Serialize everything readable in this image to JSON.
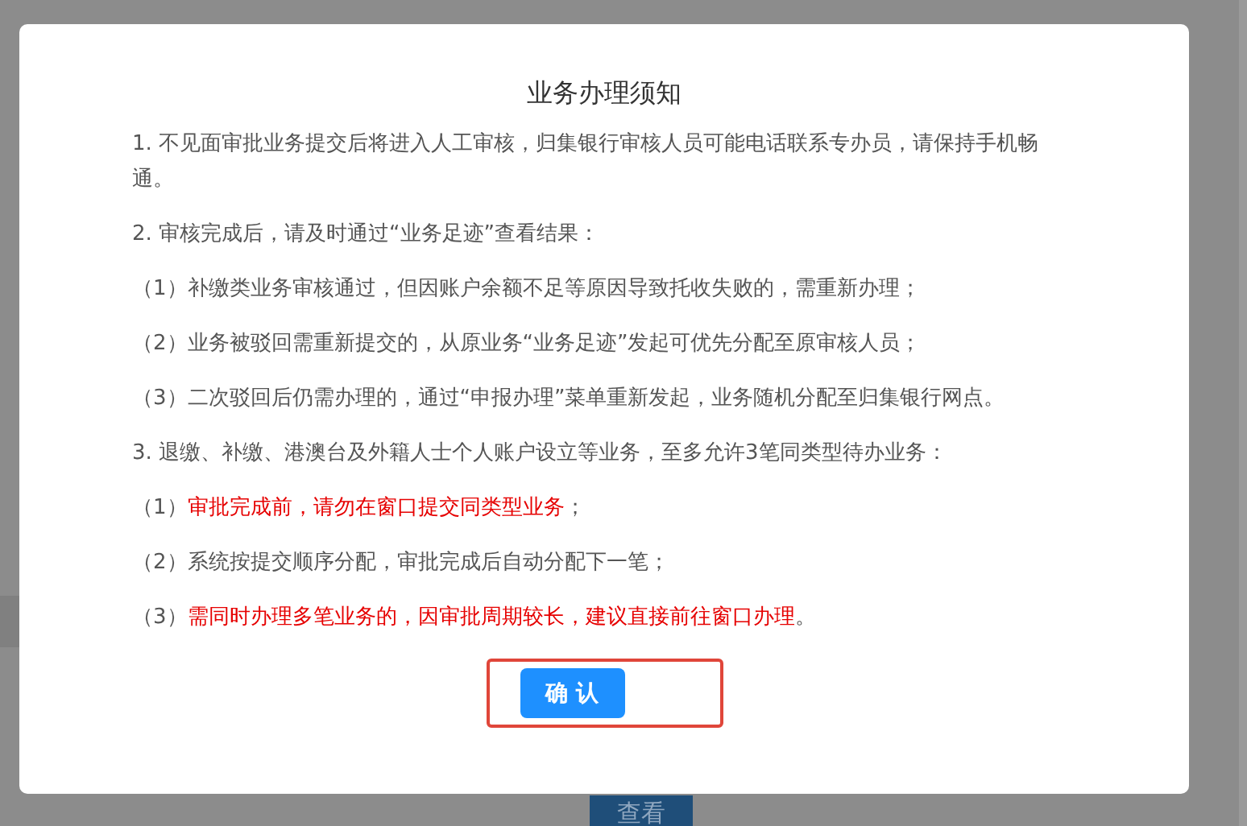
{
  "background": {
    "button": "查看"
  },
  "dialog": {
    "title": "业务办理须知",
    "paragraphs": [
      {
        "parts": [
          {
            "text": "1. 不见面审批业务提交后将进入人工审核，归集银行审核人员可能电话联系专办员，请保持手机畅通。",
            "alert": false
          }
        ]
      },
      {
        "parts": [
          {
            "text": "2. 审核完成后，请及时通过“业务足迹”查看结果：",
            "alert": false
          }
        ]
      },
      {
        "parts": [
          {
            "text": "（1）补缴类业务审核通过，但因账户余额不足等原因导致托收失败的，需重新办理；",
            "alert": false
          }
        ]
      },
      {
        "parts": [
          {
            "text": "（2）业务被驳回需重新提交的，从原业务“业务足迹”发起可优先分配至原审核人员；",
            "alert": false
          }
        ]
      },
      {
        "parts": [
          {
            "text": "（3）二次驳回后仍需办理的，通过“申报办理”菜单重新发起，业务随机分配至归集银行网点。",
            "alert": false
          }
        ]
      },
      {
        "parts": [
          {
            "text": "3. 退缴、补缴、港澳台及外籍人士个人账户设立等业务，至多允许3笔同类型待办业务：",
            "alert": false
          }
        ]
      },
      {
        "parts": [
          {
            "text": "（1）",
            "alert": false
          },
          {
            "text": "审批完成前，请勿在窗口提交同类型业务",
            "alert": true
          },
          {
            "text": "；",
            "alert": false
          }
        ]
      },
      {
        "parts": [
          {
            "text": "（2）系统按提交顺序分配，审批完成后自动分配下一笔；",
            "alert": false
          }
        ]
      },
      {
        "parts": [
          {
            "text": "（3）",
            "alert": false
          },
          {
            "text": "需同时办理多笔业务的，因审批周期较长，建议直接前往窗口办理",
            "alert": true
          },
          {
            "text": "。",
            "alert": false
          }
        ]
      }
    ],
    "confirm_button": "确 认"
  }
}
